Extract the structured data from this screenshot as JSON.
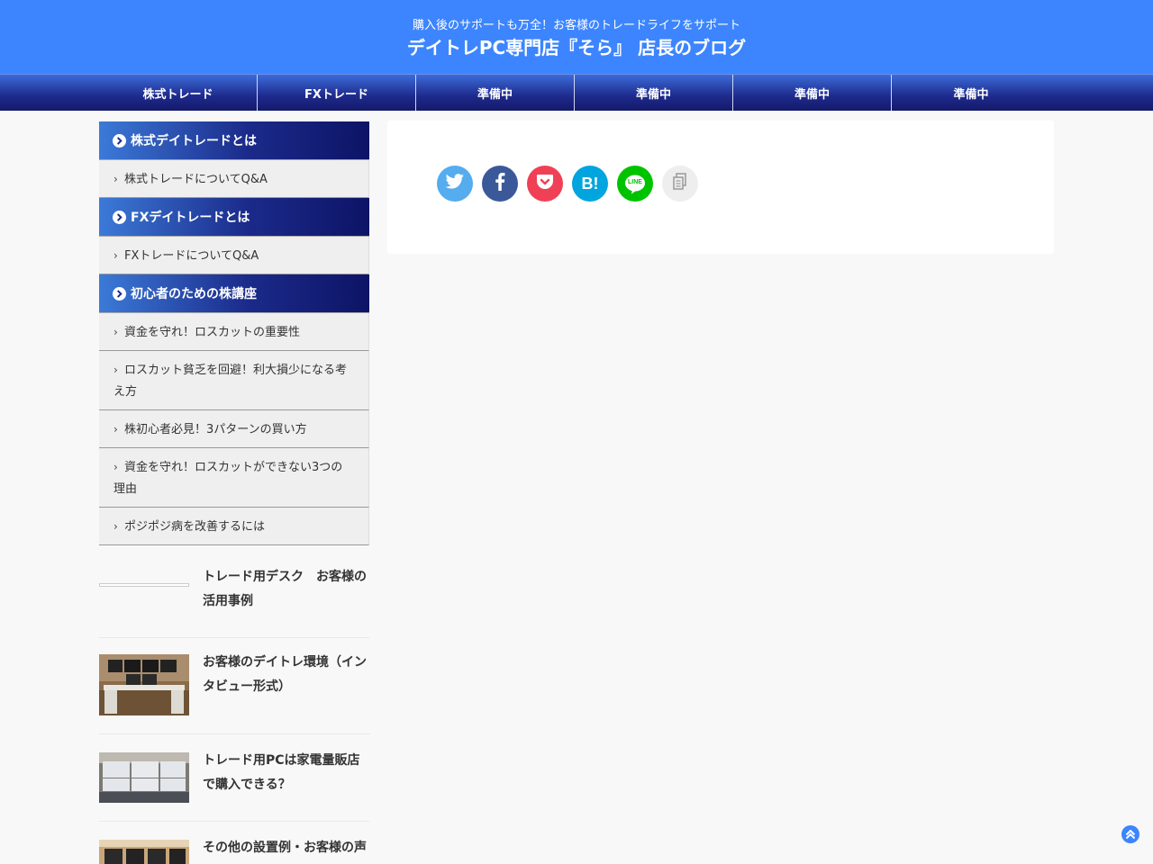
{
  "header": {
    "tagline": "購入後のサポートも万全！お客様のトレードライフをサポート",
    "title": "デイトレPC専門店『そら』 店長のブログ"
  },
  "nav": [
    "株式トレード",
    "FXトレード",
    "準備中",
    "準備中",
    "準備中",
    "準備中"
  ],
  "sidebar": {
    "categories": [
      {
        "heading": "株式デイトレードとは",
        "items": [
          "株式トレードについてQ&A"
        ]
      },
      {
        "heading": "FXデイトレードとは",
        "items": [
          "FXトレードについてQ&A"
        ]
      },
      {
        "heading": "初心者のための株講座",
        "items": [
          "資金を守れ！ロスカットの重要性",
          "ロスカット貧乏を回避！利大損少になる考え方",
          "株初心者必見！3パターンの買い方",
          "資金を守れ！ロスカットができない3つの理由",
          "ポジポジ病を改善するには"
        ]
      }
    ],
    "posts": [
      "トレード用デスク　お客様の活用事例",
      "お客様のデイトレ環境（インタビュー形式）",
      "トレード用PCは家電量販店で購入できる？",
      "その他の設置例・お客様の声"
    ]
  },
  "share": {
    "buttons": [
      "twitter-icon",
      "facebook-icon",
      "pocket-icon",
      "hatena-icon",
      "line-icon",
      "copy-icon"
    ],
    "hatena_label": "B!",
    "line_label": "LINE",
    "colors": {
      "twitter": "#55acee",
      "facebook": "#3b5998",
      "pocket": "#ef4056",
      "hatena": "#00a4de",
      "line": "#00c300",
      "copy": "#eeeeee"
    }
  },
  "accent": "#3d85fe"
}
